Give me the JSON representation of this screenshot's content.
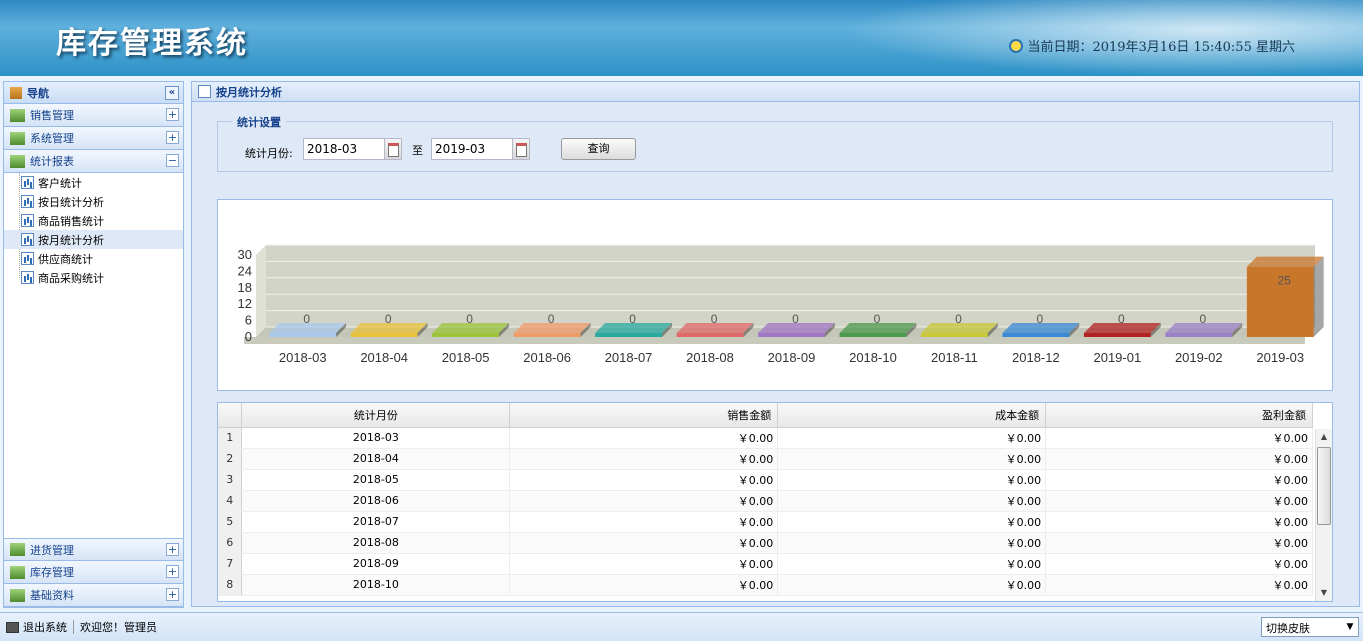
{
  "header": {
    "title": "库存管理系统",
    "date_text": "当前日期：2019年3月16日  15:40:55 星期六"
  },
  "nav": {
    "title": "导航",
    "collapse_symbol": "«",
    "sections_top": [
      {
        "label": "销售管理",
        "state": "+"
      },
      {
        "label": "系统管理",
        "state": "+"
      },
      {
        "label": "统计报表",
        "state": "−"
      }
    ],
    "report_items": [
      "客户统计",
      "按日统计分析",
      "商品销售统计",
      "按月统计分析",
      "供应商统计",
      "商品采购统计"
    ],
    "sections_bottom": [
      {
        "label": "进货管理",
        "state": "+"
      },
      {
        "label": "库存管理",
        "state": "+"
      },
      {
        "label": "基础资料",
        "state": "+"
      }
    ]
  },
  "panel": {
    "title": "按月统计分析"
  },
  "settings": {
    "legend": "统计设置",
    "month_label": "统计月份:",
    "start": "2018-03",
    "to": "至",
    "end": "2019-03",
    "query": "查询"
  },
  "chart_data": {
    "type": "bar",
    "categories": [
      "2018-03",
      "2018-04",
      "2018-05",
      "2018-06",
      "2018-07",
      "2018-08",
      "2018-09",
      "2018-10",
      "2018-11",
      "2018-12",
      "2019-01",
      "2019-02",
      "2019-03"
    ],
    "values": [
      0,
      0,
      0,
      0,
      0,
      0,
      0,
      0,
      0,
      0,
      0,
      0,
      25
    ],
    "yticks": [
      0,
      6,
      12,
      18,
      24,
      30
    ],
    "ylim": [
      0,
      30
    ],
    "colors": [
      "#a8c8ec",
      "#e8c23a",
      "#9bc43a",
      "#f09b6a",
      "#2aa9a0",
      "#e06a6a",
      "#a276c6",
      "#4c9a4c",
      "#c8c83a",
      "#3a8ad6",
      "#b22222",
      "#9b82c8",
      "#c8762a"
    ]
  },
  "grid": {
    "columns": [
      "统计月份",
      "销售金额",
      "成本金额",
      "盈利金额"
    ],
    "rows": [
      [
        "1",
        "2018-03",
        "￥0.00",
        "￥0.00",
        "￥0.00"
      ],
      [
        "2",
        "2018-04",
        "￥0.00",
        "￥0.00",
        "￥0.00"
      ],
      [
        "3",
        "2018-05",
        "￥0.00",
        "￥0.00",
        "￥0.00"
      ],
      [
        "4",
        "2018-06",
        "￥0.00",
        "￥0.00",
        "￥0.00"
      ],
      [
        "5",
        "2018-07",
        "￥0.00",
        "￥0.00",
        "￥0.00"
      ],
      [
        "6",
        "2018-08",
        "￥0.00",
        "￥0.00",
        "￥0.00"
      ],
      [
        "7",
        "2018-09",
        "￥0.00",
        "￥0.00",
        "￥0.00"
      ],
      [
        "8",
        "2018-10",
        "￥0.00",
        "￥0.00",
        "￥0.00"
      ]
    ]
  },
  "footer": {
    "logout": "退出系统",
    "welcome": "欢迎您！管理员",
    "skin": "切换皮肤"
  }
}
